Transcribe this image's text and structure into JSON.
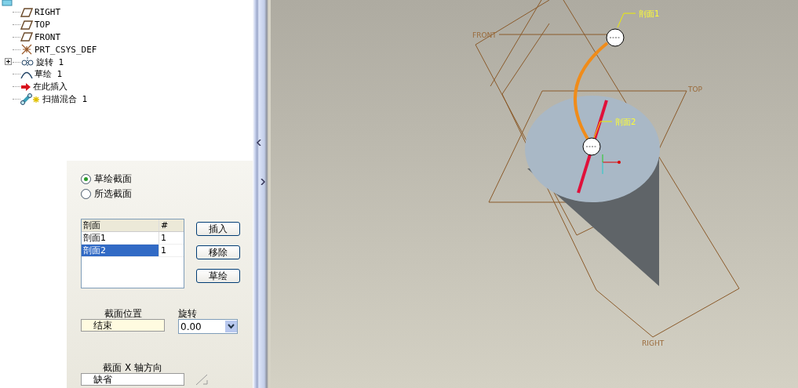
{
  "model_tree": {
    "items": [
      {
        "label": "RIGHT",
        "kind": "plane"
      },
      {
        "label": "TOP",
        "kind": "plane"
      },
      {
        "label": "FRONT",
        "kind": "plane"
      },
      {
        "label": "PRT_CSYS_DEF",
        "kind": "csys"
      },
      {
        "label": "旋转 1",
        "kind": "revolve",
        "expanded": false
      },
      {
        "label": "草绘 1",
        "kind": "sketch"
      },
      {
        "label": "在此插入",
        "kind": "insert"
      },
      {
        "label": "扫描混合 1",
        "kind": "sweep"
      }
    ]
  },
  "dialog": {
    "section_type": [
      {
        "label": "草绘截面",
        "selected": true
      },
      {
        "label": "所选截面",
        "selected": false
      }
    ],
    "sections_table": {
      "columns": [
        "剖面",
        "#"
      ],
      "rows": [
        {
          "cells": [
            "剖面1",
            "1"
          ],
          "selected": false
        },
        {
          "cells": [
            "剖面2",
            "1"
          ],
          "selected": true
        }
      ]
    },
    "buttons": [
      "插入",
      "移除",
      "草绘"
    ],
    "section_position": {
      "label": "截面位置",
      "value": "结束"
    },
    "rotation": {
      "label": "旋转",
      "value": "0.00"
    },
    "x_axis_direction": {
      "label": "截面 X 轴方向",
      "value": "缺省"
    }
  },
  "viewport": {
    "plane_labels": [
      "FRONT",
      "TOP",
      "RIGHT"
    ],
    "section_labels": [
      "剖面1",
      "剖面2"
    ]
  }
}
